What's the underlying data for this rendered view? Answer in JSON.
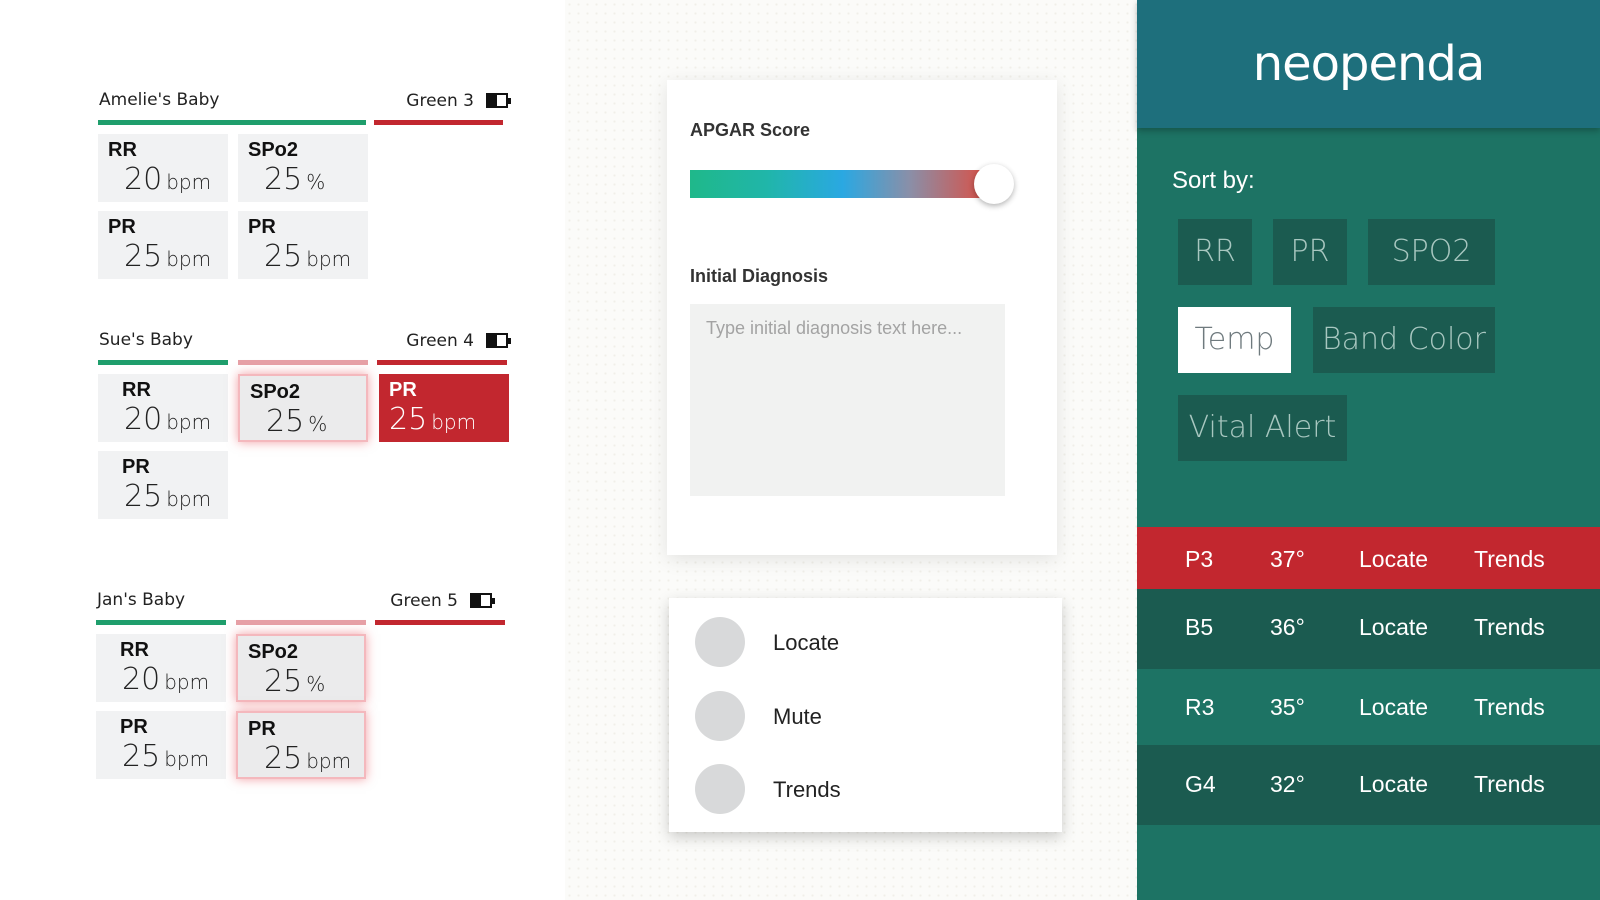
{
  "patients": [
    {
      "name": "Amelie's Baby",
      "band": "Green 3",
      "tiles": [
        {
          "label": "RR",
          "value": "20",
          "unit": "bpm"
        },
        {
          "label": "SPo2",
          "value": "25",
          "unit": "%"
        },
        {
          "label": "PR",
          "value": "25",
          "unit": "bpm"
        },
        {
          "label": "PR",
          "value": "25",
          "unit": "bpm"
        }
      ]
    },
    {
      "name": "Sue's Baby",
      "band": "Green 4",
      "tiles": [
        {
          "label": "RR",
          "value": "20",
          "unit": "bpm"
        },
        {
          "label": "SPo2",
          "value": "25",
          "unit": "%"
        },
        {
          "label": "PR",
          "value": "25",
          "unit": "bpm"
        },
        {
          "label": "PR",
          "value": "25",
          "unit": "bpm"
        }
      ]
    },
    {
      "name": "Jan's Baby",
      "band": "Green 5",
      "tiles": [
        {
          "label": "RR",
          "value": "20",
          "unit": "bpm"
        },
        {
          "label": "SPo2",
          "value": "25",
          "unit": "%"
        },
        {
          "label": "PR",
          "value": "25",
          "unit": "bpm"
        },
        {
          "label": "PR",
          "value": "25",
          "unit": "bpm"
        }
      ]
    }
  ],
  "form": {
    "apgar_label": "APGAR Score",
    "apgar_level": 1.0,
    "diagnosis_label": "Initial Diagnosis",
    "diagnosis_placeholder": "Type initial diagnosis text here...",
    "diagnosis_value": ""
  },
  "menu": {
    "items": [
      {
        "label": "Locate"
      },
      {
        "label": "Mute"
      },
      {
        "label": "Trends"
      }
    ]
  },
  "sidebar": {
    "logo": "neopenda",
    "sort_label": "Sort by:",
    "sort_options": [
      {
        "label": "RR",
        "active": false
      },
      {
        "label": "PR",
        "active": false
      },
      {
        "label": "SPO2",
        "active": false
      },
      {
        "label": "Temp",
        "active": true
      },
      {
        "label": "Band Color",
        "active": false
      },
      {
        "label": "Vital Alert",
        "active": false
      }
    ],
    "rows": [
      {
        "id": "P3",
        "temp": "37°",
        "locate": "Locate",
        "trends": "Trends",
        "color": "#c2272f"
      },
      {
        "id": "B5",
        "temp": "36°",
        "locate": "Locate",
        "trends": "Trends",
        "color": "#1b5b50"
      },
      {
        "id": "R3",
        "temp": "35°",
        "locate": "Locate",
        "trends": "Trends",
        "color": "#1d7364"
      },
      {
        "id": "G4",
        "temp": "32°",
        "locate": "Locate",
        "trends": "Trends",
        "color": "#1b5b50"
      }
    ]
  },
  "colors": {
    "alert_red": "#c2272f",
    "band_green": "#1f9e6c",
    "band_pink": "#e7a1a7",
    "panel_teal": "#1d7364",
    "logo_teal": "#1e6f7c"
  }
}
